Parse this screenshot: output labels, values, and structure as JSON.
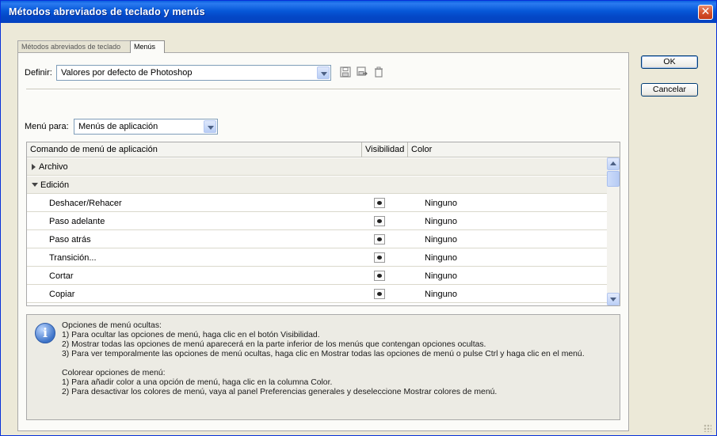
{
  "window": {
    "title": "Métodos abreviados de teclado y menús",
    "close_label": "✕"
  },
  "tabs": [
    {
      "label": "Métodos abreviados de teclado"
    },
    {
      "label": "Menús"
    }
  ],
  "definir": {
    "label": "Definir:",
    "value": "Valores por defecto de Photoshop"
  },
  "menu_para": {
    "label": "Menú para:",
    "value": "Menús de aplicación"
  },
  "table": {
    "headers": [
      "Comando de menú de aplicación",
      "Visibilidad",
      "Color"
    ],
    "groups": [
      {
        "label": "Archivo"
      },
      {
        "label": "Edición"
      }
    ],
    "rows": [
      {
        "label": "Deshacer/Rehacer",
        "color": "Ninguno"
      },
      {
        "label": "Paso adelante",
        "color": "Ninguno"
      },
      {
        "label": "Paso atrás",
        "color": "Ninguno"
      },
      {
        "label": "Transición...",
        "color": "Ninguno"
      },
      {
        "label": "Cortar",
        "color": "Ninguno"
      },
      {
        "label": "Copiar",
        "color": "Ninguno"
      }
    ]
  },
  "info": {
    "lines": [
      "Opciones de menú ocultas:",
      "1) Para ocultar las opciones de menú, haga clic en el botón Visibilidad.",
      "2) Mostrar todas las opciones de menú aparecerá en la parte inferior de los menús que contengan opciones ocultas.",
      "3) Para ver temporalmente las opciones de menú ocultas, haga clic en Mostrar todas las opciones de menú o pulse Ctrl y haga clic en el menú.",
      "Colorear opciones de menú:",
      "1) Para añadir color a una opción de menú, haga clic en la columna Color.",
      "2) Para desactivar los colores de menú, vaya al panel Preferencias generales y deseleccione Mostrar colores de menú."
    ]
  },
  "buttons": {
    "ok": "OK",
    "cancel": "Cancelar"
  },
  "icons": {
    "save": "save-icon",
    "save_as": "save-as-icon",
    "delete": "trash-icon",
    "info": "info-icon"
  }
}
